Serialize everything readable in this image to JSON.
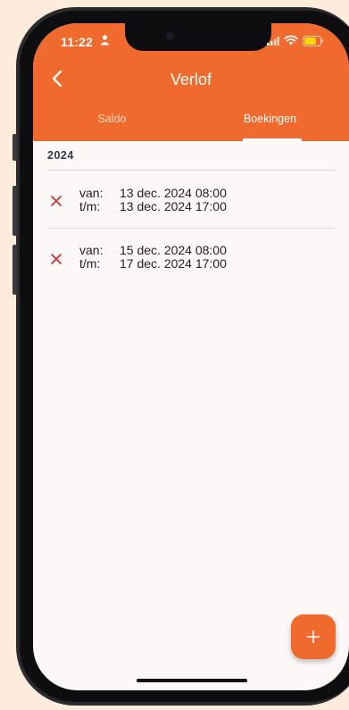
{
  "status_bar": {
    "time": "11:22"
  },
  "header": {
    "title": "Verlof"
  },
  "tabs": [
    {
      "label": "Saldo",
      "active": false
    },
    {
      "label": "Boekingen",
      "active": true
    }
  ],
  "section": {
    "year": "2024"
  },
  "bookings": [
    {
      "from_label": "van:",
      "from_value": "13 dec. 2024 08:00",
      "to_label": "t/m:",
      "to_value": "13 dec. 2024 17:00"
    },
    {
      "from_label": "van:",
      "from_value": "15 dec. 2024 08:00",
      "to_label": "t/m:",
      "to_value": "17 dec. 2024 17:00"
    }
  ],
  "fab": {
    "label": "+"
  },
  "colors": {
    "accent": "#ef6a2c",
    "delete": "#d32f2f",
    "background": "#fdebdc"
  },
  "icons": [
    "person-icon",
    "signal-icon",
    "wifi-icon",
    "battery-icon",
    "back-icon",
    "close-icon",
    "plus-icon"
  ]
}
